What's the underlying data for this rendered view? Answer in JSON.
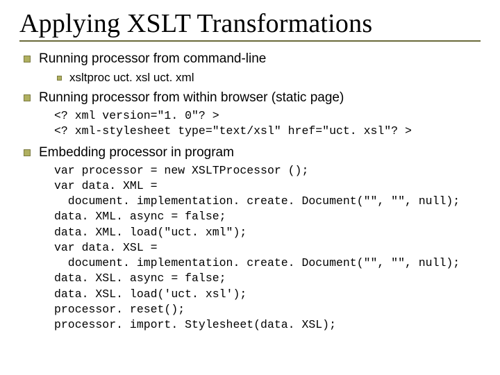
{
  "title": "Applying XSLT Transformations",
  "bullets": {
    "b1": {
      "text": "Running processor from command-line",
      "sub1": "xsltproc uct. xsl uct. xml"
    },
    "b2": {
      "text": "Running processor from within browser (static page)",
      "code": [
        "<? xml version=\"1. 0\"? >",
        "<? xml-stylesheet type=\"text/xsl\" href=\"uct. xsl\"? >"
      ]
    },
    "b3": {
      "text": "Embedding processor in program",
      "code": [
        "var processor = new XSLTProcessor ();",
        "var data. XML =",
        "  document. implementation. create. Document(\"\", \"\", null);",
        "data. XML. async = false;",
        "data. XML. load(\"uct. xml\");",
        "var data. XSL =",
        "  document. implementation. create. Document(\"\", \"\", null);",
        "data. XSL. async = false;",
        "data. XSL. load('uct. xsl');",
        "processor. reset();",
        "processor. import. Stylesheet(data. XSL);"
      ]
    }
  }
}
